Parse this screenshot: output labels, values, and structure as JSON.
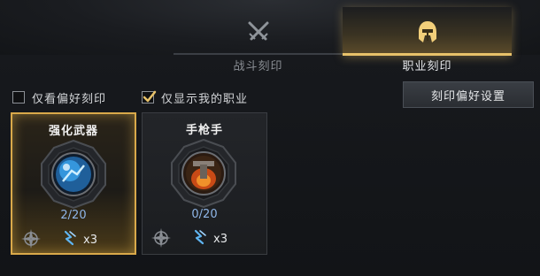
{
  "tabs": [
    {
      "label": "战斗刻印",
      "icon": "crossed-swords-icon",
      "active": false
    },
    {
      "label": "职业刻印",
      "icon": "helmet-icon",
      "active": true
    }
  ],
  "filters": [
    {
      "label": "仅看偏好刻印",
      "checked": false
    },
    {
      "label": "仅显示我的职业",
      "checked": true
    }
  ],
  "settings_button": {
    "label": "刻印偏好设置"
  },
  "cards": [
    {
      "name": "强化武器",
      "progress": "2/20",
      "cost": "x3",
      "selected": true,
      "icon": "blue-orb-icon"
    },
    {
      "name": "手枪手",
      "progress": "0/20",
      "cost": "x3",
      "selected": false,
      "icon": "pistol-flame-icon"
    }
  ],
  "colors": {
    "accent": "#e8c26a",
    "progress": "#8fb6e8",
    "selected_border": "#d9a94a"
  }
}
